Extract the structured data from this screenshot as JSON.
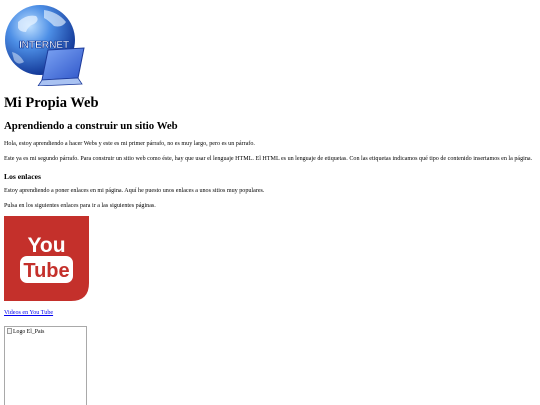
{
  "logo": {
    "text": "INTERNET"
  },
  "page_title": "Mi Propia Web",
  "subtitle": "Aprendiendo a construir un sitio Web",
  "paragraphs": [
    "Hola, estoy aprendiendo a hacer Webs y este es mi primer párrafo, no es muy largo, pero es un párrafo.",
    "Este ya es mi segundo párrafo. Para construir un sitio web como éste, hay que usar el lenguaje HTML. El HTML es un lenguaje de etiquetas. Con las etiquetas indicamos qué tipo de contenido insertamos en la página."
  ],
  "links_section": {
    "heading": "Los enlaces",
    "paragraphs": [
      "Estoy aprendiendo a poner enlaces en mi página. Aquí he puesto unos enlaces a unos sitios muy populares.",
      "Pulsa en los siguientes enlaces para ir a las siguientes páginas."
    ],
    "youtube_logo": {
      "line1": "You",
      "line2": "Tube",
      "color": "#c4302b"
    },
    "youtube_link": "Videos en You Tube",
    "elpais_image_alt": "Logo El_Pais"
  },
  "colors": {
    "link": "#0000ee",
    "globe_dark": "#1b3fa8",
    "globe_light": "#6fb0f0"
  }
}
